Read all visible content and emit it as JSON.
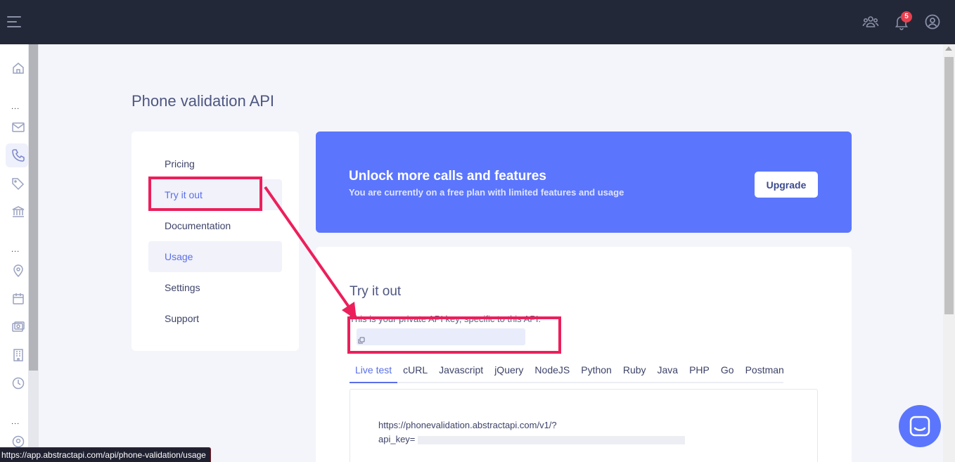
{
  "page": {
    "title": "Phone validation API"
  },
  "topbar": {
    "notification_count": "5"
  },
  "sidebar": {
    "dots": "..."
  },
  "menu": {
    "items": [
      {
        "label": "Pricing",
        "active": false
      },
      {
        "label": "Try it out",
        "active": true
      },
      {
        "label": "Documentation",
        "active": false
      },
      {
        "label": "Usage",
        "active": true
      },
      {
        "label": "Settings",
        "active": false
      },
      {
        "label": "Support",
        "active": false
      }
    ]
  },
  "banner": {
    "title": "Unlock more calls and features",
    "subtitle": "You are currently on a free plan with limited features and usage",
    "button_label": "Upgrade"
  },
  "try_it_out": {
    "title": "Try it out",
    "description": "This is your private API key, specific to this API.",
    "tabs": [
      "Live test",
      "cURL",
      "Javascript",
      "jQuery",
      "NodeJS",
      "Python",
      "Ruby",
      "Java",
      "PHP",
      "Go",
      "Postman"
    ],
    "active_tab": "Live test",
    "code_line1": "https://phonevalidation.abstractapi.com/v1/?",
    "code_line2_prefix": "api_key="
  },
  "status_bar": {
    "url": "https://app.abstractapi.com/api/phone-validation/usage"
  },
  "colors": {
    "topbar": "#232838",
    "accent": "#5b76fd",
    "highlight": "#ec1f5b",
    "badge": "#e8404f"
  }
}
